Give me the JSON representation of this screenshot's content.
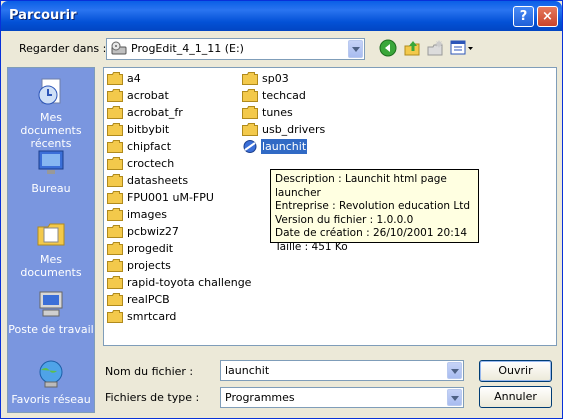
{
  "window": {
    "title": "Parcourir",
    "help_glyph": "?",
    "close_glyph": "×"
  },
  "lookin": {
    "label": "Regarder dans :",
    "value": "ProgEdit_4_1_11 (E:)"
  },
  "toolbar": {
    "icons": [
      "back-icon",
      "up-folder-icon",
      "new-folder-icon",
      "view-menu-icon"
    ]
  },
  "places": [
    {
      "label": "Mes documents récents",
      "icon": "recent-documents-icon"
    },
    {
      "label": "Bureau",
      "icon": "desktop-icon"
    },
    {
      "label": "Mes documents",
      "icon": "my-documents-icon"
    },
    {
      "label": "Poste de travail",
      "icon": "my-computer-icon"
    },
    {
      "label": "Favoris réseau",
      "icon": "network-places-icon"
    }
  ],
  "files": {
    "col1": [
      "a4",
      "acrobat",
      "acrobat_fr",
      "bitbybit",
      "chipfact",
      "croctech",
      "datasheets",
      "FPU001 uM-FPU",
      "images",
      "pcbwiz27",
      "progedit",
      "projects",
      "rapid-toyota challenge",
      "realPCB",
      "smrtcard"
    ],
    "col2": [
      "sp03",
      "techcad",
      "tunes",
      "usb_drivers"
    ],
    "selected": "launchit"
  },
  "tooltip": {
    "line1": "Description : Launchit html page launcher",
    "line2": "Entreprise : Revolution education Ltd",
    "line3": "Version du fichier : 1.0.0.0",
    "line4": "Date de création : 26/10/2001 20:14",
    "line5": "Taille  : 451 Ko"
  },
  "filename": {
    "label": "Nom du fichier :",
    "value": "launchit"
  },
  "filetype": {
    "label": "Fichiers de type :",
    "value": "Programmes"
  },
  "buttons": {
    "open": "Ouvrir",
    "cancel": "Annuler"
  },
  "colors": {
    "titlebar": "#0a5fe6",
    "places_bg": "#7a96df",
    "selection": "#316ac5",
    "dialog_bg": "#ece9d8"
  }
}
